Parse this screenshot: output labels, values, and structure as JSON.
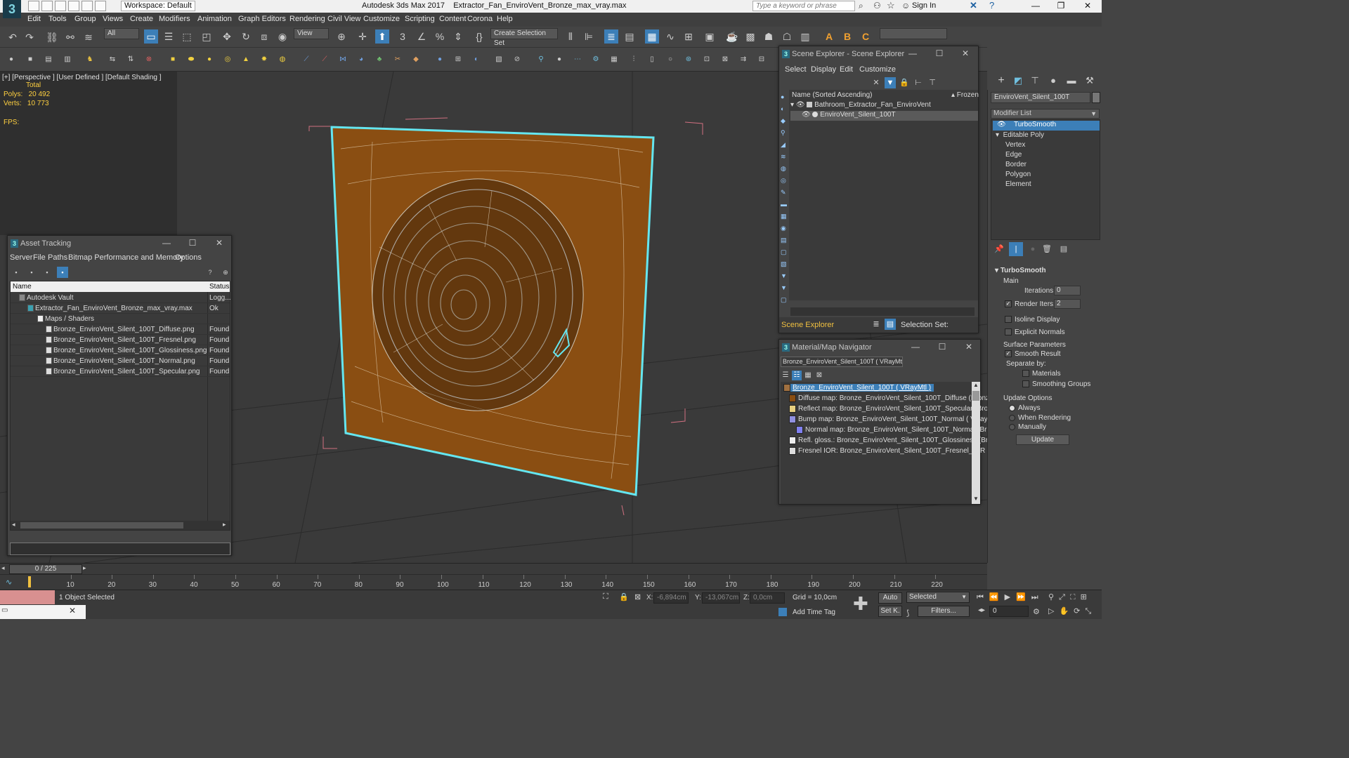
{
  "titlebar": {
    "workspace": "Workspace: Default",
    "app": "Autodesk 3ds Max 2017",
    "file": "Extractor_Fan_EnviroVent_Bronze_max_vray.max",
    "search_placeholder": "Type a keyword or phrase",
    "sign_in": "Sign In"
  },
  "menu": [
    "Edit",
    "Tools",
    "Group",
    "Views",
    "Create",
    "Modifiers",
    "Animation",
    "Graph Editors",
    "Rendering",
    "Civil View",
    "Customize",
    "Scripting",
    "Content",
    "Corona",
    "Help"
  ],
  "toolbar": {
    "filter": "All",
    "coord_system": "View",
    "named_sel": "Create Selection Set"
  },
  "viewport": {
    "label": "[+] [Perspective ] [User Defined ] [Default Shading ]",
    "stats": {
      "total_label": "Total",
      "polys_label": "Polys:",
      "polys": "20 492",
      "verts_label": "Verts:",
      "verts": "10 773",
      "fps_label": "FPS:"
    }
  },
  "asset_tracking": {
    "title": "Asset Tracking",
    "menu": [
      "Server",
      "File",
      "Paths",
      "Bitmap Performance and Memory",
      "Options"
    ],
    "col_name": "Name",
    "col_status": "Status",
    "rows": [
      {
        "name": "Autodesk Vault",
        "status": "Logg..."
      },
      {
        "name": "Extractor_Fan_EnviroVent_Bronze_max_vray.max",
        "status": "Ok"
      },
      {
        "name": "Maps / Shaders",
        "status": ""
      },
      {
        "name": "Bronze_EnviroVent_Silent_100T_Diffuse.png",
        "status": "Found"
      },
      {
        "name": "Bronze_EnviroVent_Silent_100T_Fresnel.png",
        "status": "Found"
      },
      {
        "name": "Bronze_EnviroVent_Silent_100T_Glossiness.png",
        "status": "Found"
      },
      {
        "name": "Bronze_EnviroVent_Silent_100T_Normal.png",
        "status": "Found"
      },
      {
        "name": "Bronze_EnviroVent_Silent_100T_Specular.png",
        "status": "Found"
      }
    ]
  },
  "scene_explorer": {
    "title": "Scene Explorer - Scene Explorer",
    "menu": [
      "Select",
      "Display",
      "Edit",
      "Customize"
    ],
    "col_name": "Name (Sorted Ascending)",
    "col_frozen": "▴ Frozen",
    "items": [
      "Bathroom_Extractor_Fan_EnviroVent",
      "EnviroVent_Silent_100T"
    ],
    "footer_left": "Scene Explorer",
    "footer_right": "Selection Set:"
  },
  "material_nav": {
    "title": "Material/Map Navigator",
    "current": "Bronze_EnviroVent_Silent_100T  ( VRayMtl )",
    "items": [
      "Bronze_EnviroVent_Silent_100T  ( VRayMtl )",
      "Diffuse map: Bronze_EnviroVent_Silent_100T_Diffuse (Bronze",
      "Reflect map: Bronze_EnviroVent_Silent_100T_Specular (Bronz",
      "Bump map: Bronze_EnviroVent_Silent_100T_Normal  ( VRayN",
      "Normal map: Bronze_EnviroVent_Silent_100T_Normal (Bronz",
      "Refl. gloss.: Bronze_EnviroVent_Silent_100T_Glossiness (Bronz",
      "Fresnel IOR: Bronze_EnviroVent_Silent_100T_Fresnel_IOR (Br"
    ]
  },
  "command_panel": {
    "object_name": "EnviroVent_Silent_100T",
    "modifier_list": "Modifier List",
    "stack": [
      "TurboSmooth",
      "Editable Poly",
      "Vertex",
      "Edge",
      "Border",
      "Polygon",
      "Element"
    ],
    "turbosmooth": {
      "header": "TurboSmooth",
      "main": "Main",
      "iterations_label": "Iterations:",
      "iterations": "0",
      "render_iters_label": "Render Iters:",
      "render_iters": "2",
      "isoline": "Isoline Display",
      "explicit": "Explicit Normals",
      "surface": "Surface Parameters",
      "smooth": "Smooth Result",
      "separate": "Separate by:",
      "materials": "Materials",
      "smoothing_groups": "Smoothing Groups",
      "update_options": "Update Options",
      "always": "Always",
      "when_rendering": "When Rendering",
      "manually": "Manually",
      "update": "Update"
    }
  },
  "timeline": {
    "frame": "0 / 225",
    "ticks": [
      "10",
      "20",
      "30",
      "40",
      "50",
      "60",
      "70",
      "80",
      "90",
      "100",
      "110",
      "120",
      "130",
      "140",
      "150",
      "160",
      "170",
      "180",
      "190",
      "200",
      "210",
      "220"
    ]
  },
  "status": {
    "selected": "1 Object Selected",
    "x_label": "X:",
    "x": "-6,894cm",
    "y_label": "Y:",
    "y": "-13,067cm",
    "z_label": "Z:",
    "z": "0,0cm",
    "grid": "Grid = 10,0cm",
    "auto": "Auto",
    "selected_mode": "Selected",
    "setk": "Set K.",
    "filters": "Filters...",
    "add_time_tag": "Add Time Tag",
    "frame_field": "0"
  }
}
